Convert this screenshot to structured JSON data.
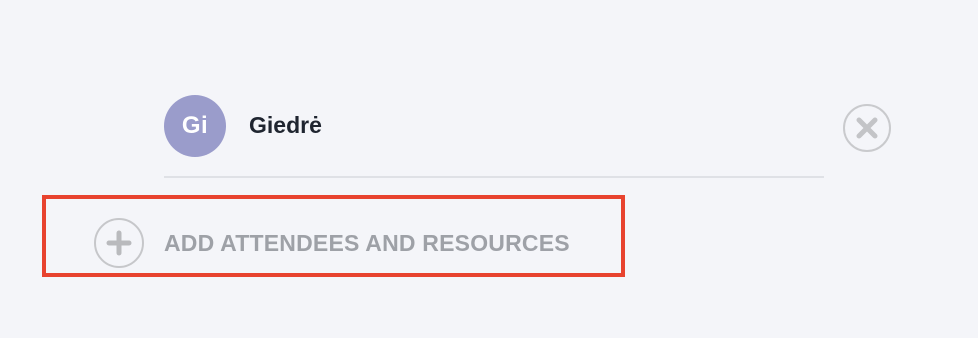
{
  "attendee": {
    "initials": "Gi",
    "name": "Giedrė",
    "avatar_color": "#9a9ccb"
  },
  "remove_button": {
    "icon": "close-icon"
  },
  "add_attendees": {
    "label": "ADD ATTENDEES AND RESOURCES",
    "icon": "plus-icon"
  },
  "highlight": {
    "color": "#e8432f"
  }
}
